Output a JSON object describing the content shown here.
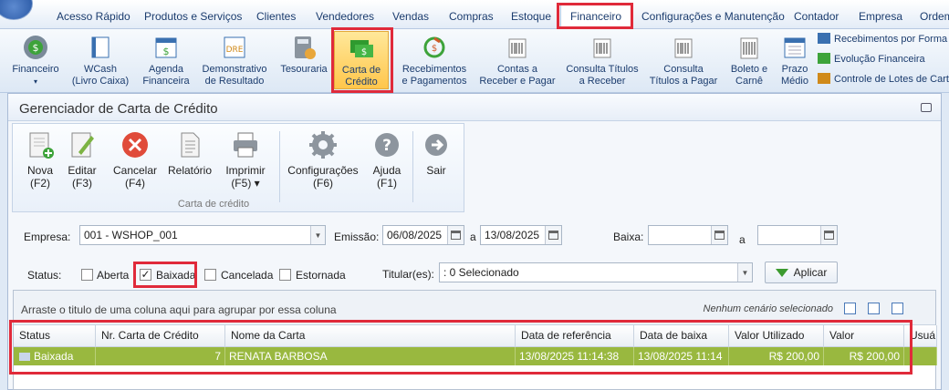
{
  "menu": {
    "tabs": [
      "Acesso Rápido",
      "Produtos e Serviços",
      "Clientes",
      "Vendedores",
      "Vendas",
      "Compras",
      "Estoque",
      "Financeiro",
      "Configurações e Manutenção",
      "Contador",
      "Empresa",
      "Ordem"
    ],
    "active": "Financeiro"
  },
  "ribbon": {
    "financeiro": "Financeiro",
    "wcash": [
      "WCash",
      "(Livro Caixa)"
    ],
    "agenda": [
      "Agenda",
      "Financeira"
    ],
    "dre": [
      "Demonstrativo",
      "de Resultado"
    ],
    "dre_icon_text": "DRE",
    "tesouraria": "Tesouraria",
    "carta": [
      "Carta de",
      "Crédito"
    ],
    "recebimentos": [
      "Recebimentos",
      "e Pagamentos"
    ],
    "contas": [
      "Contas a",
      "Receber e Pagar"
    ],
    "consulta_receber": [
      "Consulta Títulos",
      "a Receber"
    ],
    "consulta_pagar": [
      "Consulta",
      "Títulos a Pagar"
    ],
    "boleto": [
      "Boleto e",
      "Carnê"
    ],
    "prazo": [
      "Prazo",
      "Médio"
    ],
    "side_items": [
      "Recebimentos por Forma de",
      "Evolução Financeira",
      "Controle de Lotes de Cartã"
    ]
  },
  "window": {
    "title": "Gerenciador de Carta de Crédito"
  },
  "toolbar": {
    "nova": [
      "Nova",
      "(F2)"
    ],
    "editar": [
      "Editar",
      "(F3)"
    ],
    "cancelar": [
      "Cancelar",
      "(F4)"
    ],
    "relatorio": "Relatório",
    "imprimir": [
      "Imprimir",
      "(F5) ▾"
    ],
    "configuracoes": [
      "Configurações",
      "(F6)"
    ],
    "ajuda": [
      "Ajuda",
      "(F1)"
    ],
    "sair": "Sair",
    "group_label": "Carta de crédito"
  },
  "filters": {
    "empresa_label": "Empresa:",
    "empresa_value": "001 - WSHOP_001",
    "emissao_label": "Emissão:",
    "emissao_from": "06/08/2025",
    "emissao_sep": "a",
    "emissao_to": "13/08/2025",
    "baixa_label": "Baixa:",
    "baixa_sep": "a",
    "status_label": "Status:",
    "status_options": [
      "Aberta",
      "Baixada",
      "Cancelada",
      "Estornada"
    ],
    "status_checked": "Baixada",
    "titular_label": "Titular(es):",
    "titular_value": ": 0 Selecionado",
    "apply_label": "Aplicar"
  },
  "grid": {
    "group_hint": "Arraste o titulo de uma coluna aqui para agrupar por essa coluna",
    "scenario": "Nenhum cenário selecionado",
    "columns": [
      "Status",
      "Nr. Carta de Crédito",
      "Nome da Carta",
      "Data de referência",
      "Data de baixa",
      "Valor Utilizado",
      "Valor",
      "Usuá"
    ],
    "rows": [
      [
        "Baixada",
        "7",
        "RENATA BARBOSA",
        "13/08/2025 11:14:38",
        "13/08/2025 11:14",
        "R$ 200,00",
        "R$ 200,00",
        ""
      ]
    ]
  }
}
